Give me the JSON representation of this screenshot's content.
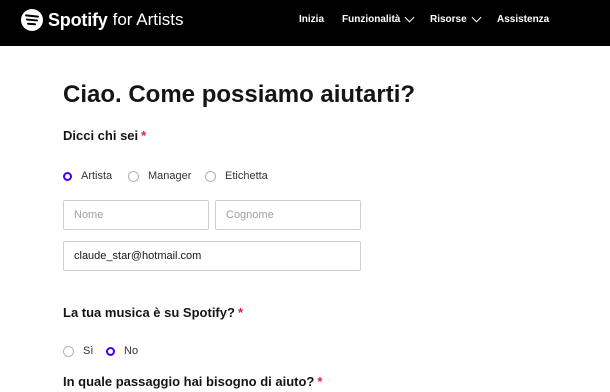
{
  "header": {
    "brand": "Spotify",
    "brand_suffix": "for Artists",
    "nav": [
      {
        "label": "Inizia"
      },
      {
        "label": "Funzionalità"
      },
      {
        "label": "Risorse"
      },
      {
        "label": "Assistenza"
      }
    ]
  },
  "form": {
    "title": "Ciao. Come possiamo aiutarti?",
    "who_label": "Dicci chi sei",
    "required_mark": "*",
    "role_options": [
      {
        "label": "Artista",
        "selected": true
      },
      {
        "label": "Manager",
        "selected": false
      },
      {
        "label": "Etichetta",
        "selected": false
      }
    ],
    "first_name": {
      "placeholder": "Nome",
      "value": ""
    },
    "last_name": {
      "placeholder": "Cognome",
      "value": ""
    },
    "email": {
      "placeholder": "",
      "value": "claude_star@hotmail.com"
    },
    "on_spotify_label": "La tua musica è su Spotify?",
    "on_spotify_options": [
      {
        "label": "Sì",
        "selected": false
      },
      {
        "label": "No",
        "selected": true
      }
    ],
    "help_label": "In quale passaggio hai bisogno di aiuto?"
  },
  "colors": {
    "accent": "#4100f4",
    "required": "#e22134",
    "topbar": "#000000"
  }
}
